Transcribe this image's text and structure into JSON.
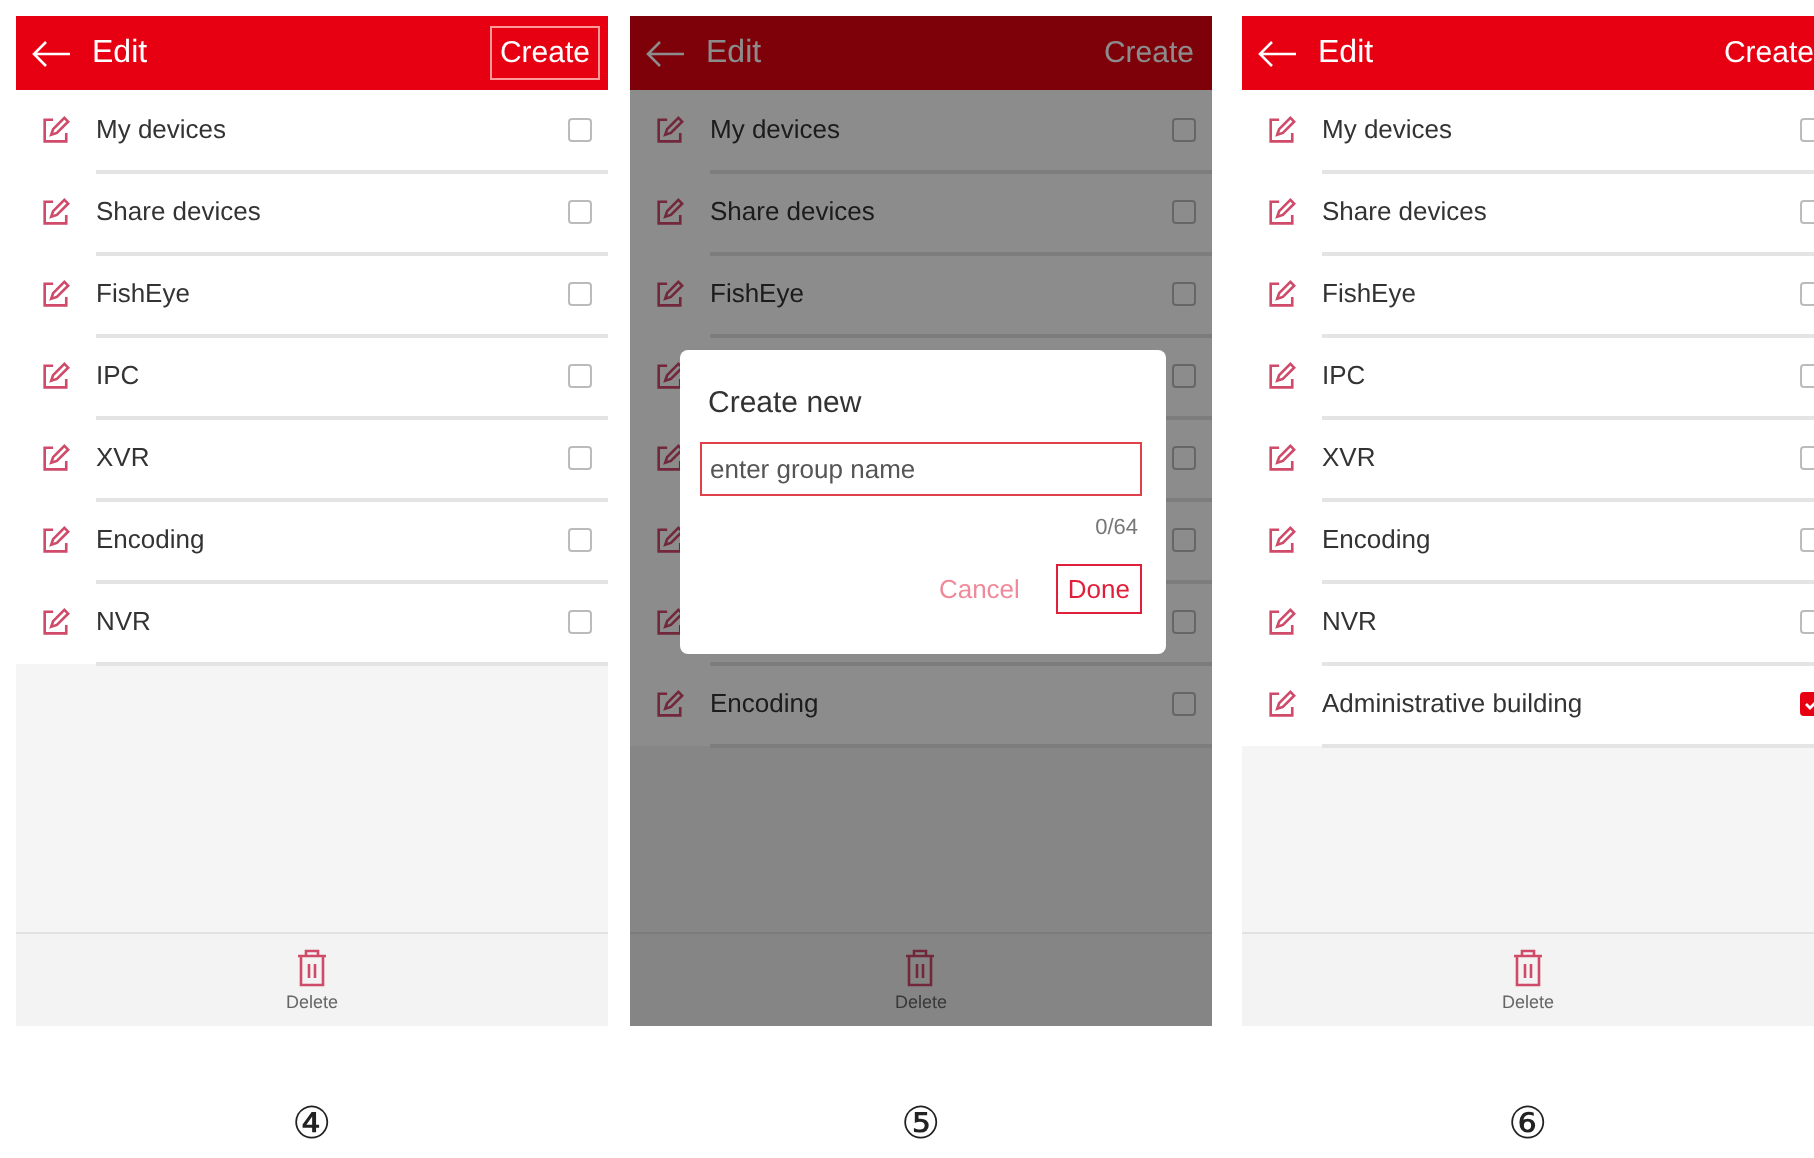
{
  "screens": [
    {
      "title": "Edit",
      "action": {
        "label": "Create",
        "highlighted": true
      },
      "rows": [
        {
          "label": "My devices",
          "checked": false
        },
        {
          "label": "Share devices",
          "checked": false
        },
        {
          "label": "FishEye",
          "checked": false
        },
        {
          "label": "IPC",
          "checked": false
        },
        {
          "label": "XVR",
          "checked": false
        },
        {
          "label": "Encoding",
          "checked": false
        },
        {
          "label": "NVR",
          "checked": false
        }
      ],
      "delete_label": "Delete",
      "caption": "④"
    },
    {
      "title": "Edit",
      "action": {
        "label": "Create",
        "highlighted": false
      },
      "rows": [
        {
          "label": "My devices",
          "checked": false
        },
        {
          "label": "Share devices",
          "checked": false
        },
        {
          "label": "FishEye",
          "checked": false
        },
        {
          "checked": false
        },
        {
          "checked": false
        },
        {
          "checked": false
        },
        {
          "checked": false
        },
        {
          "label": "Encoding",
          "checked": false
        }
      ],
      "delete_label": "Delete",
      "caption": "⑤",
      "dialog": {
        "title": "Create new",
        "placeholder": "enter group name",
        "counter": "0/64",
        "buttons": [
          {
            "label": "Cancel",
            "kind": "secondary",
            "highlighted": false
          },
          {
            "label": "Done",
            "kind": "primary",
            "highlighted": true
          }
        ]
      }
    },
    {
      "title": "Edit",
      "action": {
        "label": "Create",
        "highlighted": false
      },
      "rows": [
        {
          "label": "My devices",
          "checked": false
        },
        {
          "label": "Share devices",
          "checked": false
        },
        {
          "label": "FishEye",
          "checked": false
        },
        {
          "label": "IPC",
          "checked": false
        },
        {
          "label": "XVR",
          "checked": false
        },
        {
          "label": "Encoding",
          "checked": false
        },
        {
          "label": "NVR",
          "checked": false
        },
        {
          "label": "Administrative building",
          "checked": true
        }
      ],
      "delete_label": "Delete",
      "caption": "⑥"
    }
  ]
}
